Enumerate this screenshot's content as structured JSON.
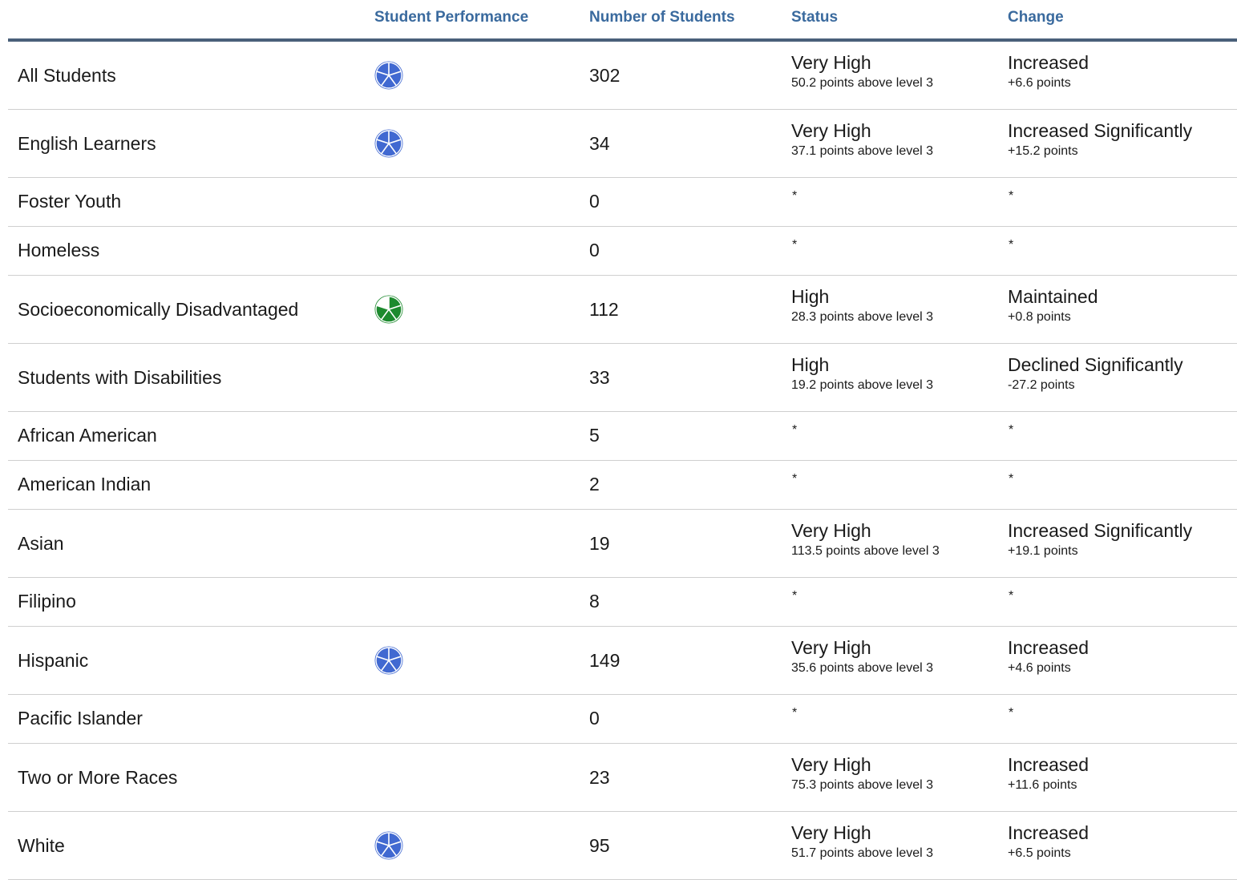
{
  "header": {
    "performance": "Student Performance",
    "count": "Number of Students",
    "status": "Status",
    "change": "Change"
  },
  "colors": {
    "blue_icon": "#4169d1",
    "green_icon": "#1d8a2e",
    "header_text": "#3a6a9e",
    "header_rule": "#4a607a"
  },
  "rows": [
    {
      "group": "All Students",
      "icon": "blue-pie-icon",
      "count": "302",
      "status": "Very High",
      "status_detail": "50.2 points above level 3",
      "change": "Increased",
      "change_detail": "+6.6 points"
    },
    {
      "group": "English Learners",
      "icon": "blue-pie-icon",
      "count": "34",
      "status": "Very High",
      "status_detail": "37.1 points above level 3",
      "change": "Increased Significantly",
      "change_detail": "+15.2 points"
    },
    {
      "group": "Foster Youth",
      "count": "0",
      "status": "*",
      "change": "*"
    },
    {
      "group": "Homeless",
      "count": "0",
      "status": "*",
      "change": "*"
    },
    {
      "group": "Socioeconomically Disadvantaged",
      "icon": "green-pie-icon",
      "count": "112",
      "status": "High",
      "status_detail": "28.3 points above level 3",
      "change": "Maintained",
      "change_detail": "+0.8 points"
    },
    {
      "group": "Students with Disabilities",
      "count": "33",
      "status": "High",
      "status_detail": "19.2 points above level 3",
      "change": "Declined Significantly",
      "change_detail": "-27.2 points"
    },
    {
      "group": "African American",
      "count": "5",
      "status": "*",
      "change": "*"
    },
    {
      "group": "American Indian",
      "count": "2",
      "status": "*",
      "change": "*"
    },
    {
      "group": "Asian",
      "count": "19",
      "status": "Very High",
      "status_detail": "113.5 points above level 3",
      "change": "Increased Significantly",
      "change_detail": "+19.1 points"
    },
    {
      "group": "Filipino",
      "count": "8",
      "status": "*",
      "change": "*"
    },
    {
      "group": "Hispanic",
      "icon": "blue-pie-icon",
      "count": "149",
      "status": "Very High",
      "status_detail": "35.6 points above level 3",
      "change": "Increased",
      "change_detail": "+4.6 points"
    },
    {
      "group": "Pacific Islander",
      "count": "0",
      "status": "*",
      "change": "*"
    },
    {
      "group": "Two or More Races",
      "count": "23",
      "status": "Very High",
      "status_detail": "75.3 points above level 3",
      "change": "Increased",
      "change_detail": "+11.6 points"
    },
    {
      "group": "White",
      "icon": "blue-pie-icon",
      "count": "95",
      "status": "Very High",
      "status_detail": "51.7 points above level 3",
      "change": "Increased",
      "change_detail": "+6.5 points"
    }
  ]
}
